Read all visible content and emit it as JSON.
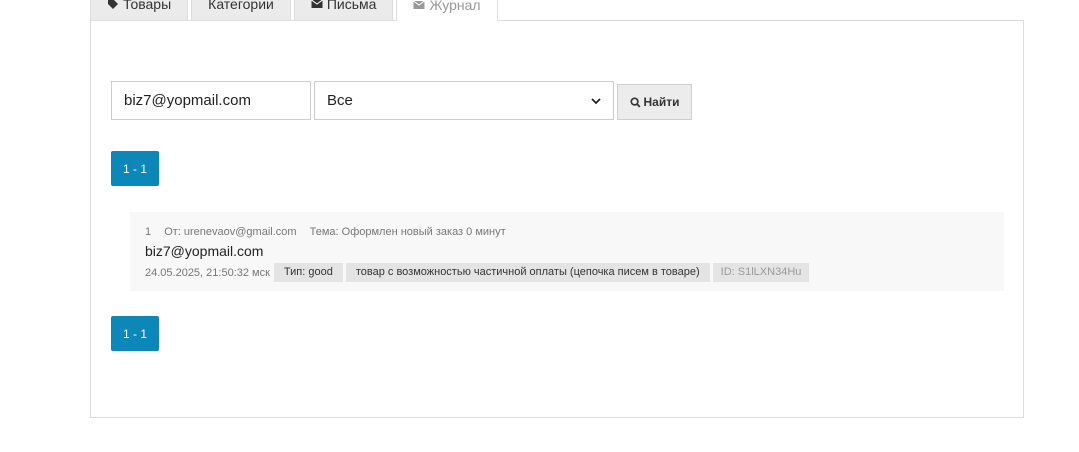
{
  "tabs": [
    {
      "label": "Товары",
      "icon": "tag-icon"
    },
    {
      "label": "Категории",
      "icon": null
    },
    {
      "label": "Письма",
      "icon": "envelope-icon"
    },
    {
      "label": "Журнал",
      "icon": "envelope-icon",
      "active": true
    }
  ],
  "filter": {
    "email_value": "biz7@yopmail.com",
    "type_selected": "Все",
    "search_label": "Найти"
  },
  "pagination": {
    "label": "1 - 1"
  },
  "entries": [
    {
      "index": "1",
      "from": "От: urenevaov@gmail.com",
      "subject": "Тема: Оформлен новый заказ 0 минут",
      "recipient": "biz7@yopmail.com",
      "timestamp": "24.05.2025, 21:50:32 мск",
      "type": "Тип: good",
      "description": "товар с возможностью частичной оплаты (цепочка писем в товаре)",
      "id": "ID: S1lLXN34Hu"
    }
  ],
  "colors": {
    "accent": "#0b87b8",
    "entry_bg": "#f8f8f8",
    "badge_bg": "#e4e4e4"
  }
}
